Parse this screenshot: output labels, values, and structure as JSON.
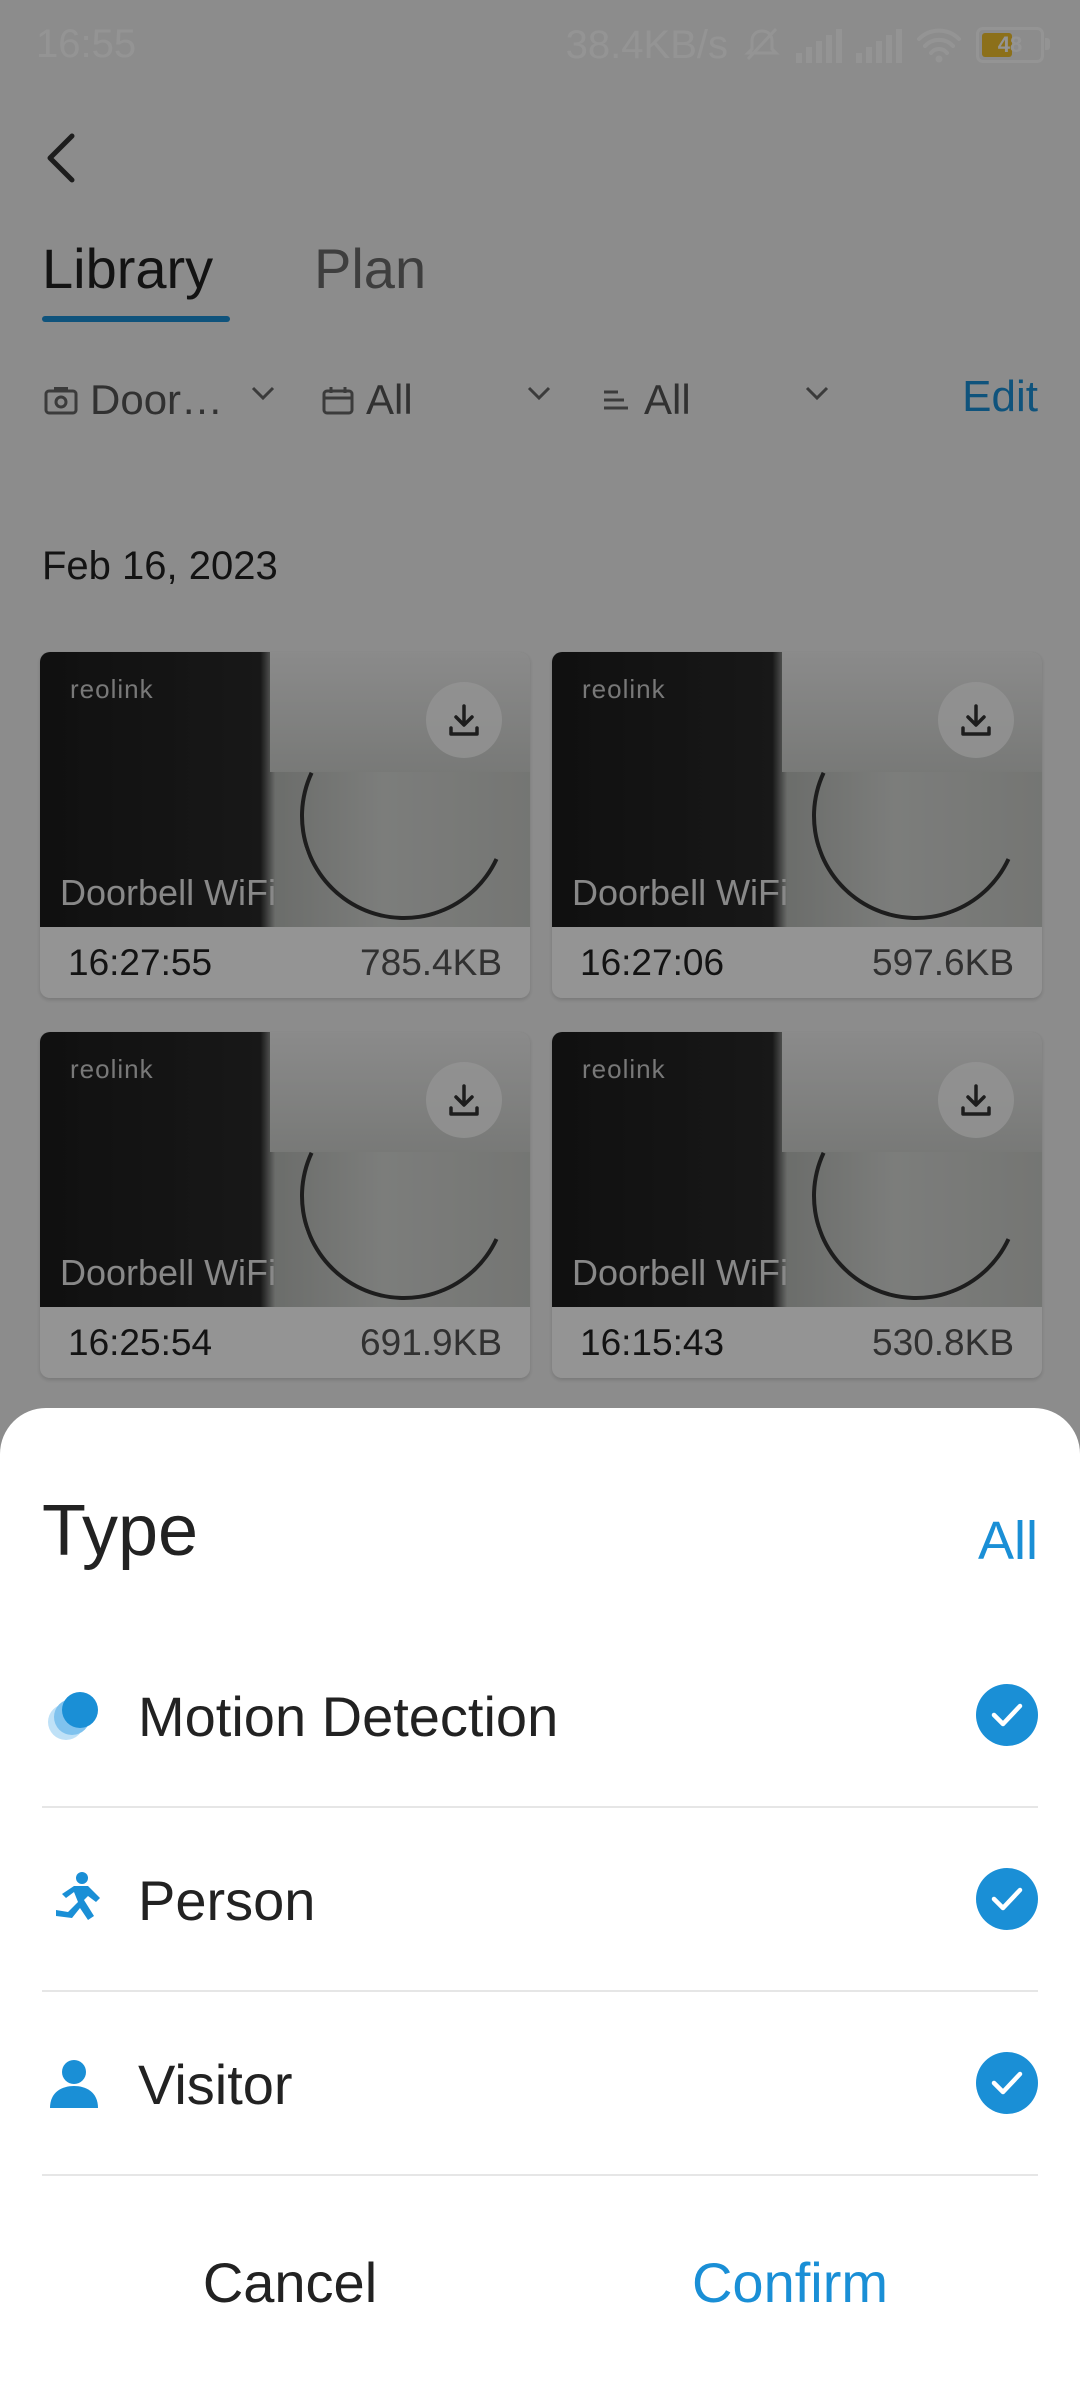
{
  "status_bar": {
    "time": "16:55",
    "network_speed": "38.4KB/s",
    "battery": "48"
  },
  "tabs": [
    {
      "label": "Library"
    },
    {
      "label": "Plan"
    }
  ],
  "filters": {
    "camera": "Door…",
    "date": "All",
    "type": "All",
    "edit_label": "Edit"
  },
  "date_header": "Feb 16, 2023",
  "recordings": [
    {
      "brand": "reolink",
      "camera": "Doorbell WiFi",
      "time": "16:27:55",
      "size": "785.4KB"
    },
    {
      "brand": "reolink",
      "camera": "Doorbell WiFi",
      "time": "16:27:06",
      "size": "597.6KB"
    },
    {
      "brand": "reolink",
      "camera": "Doorbell WiFi",
      "time": "16:25:54",
      "size": "691.9KB"
    },
    {
      "brand": "reolink",
      "camera": "Doorbell WiFi",
      "time": "16:15:43",
      "size": "530.8KB"
    }
  ],
  "sheet": {
    "title": "Type",
    "all_label": "All",
    "options": [
      {
        "label": "Motion Detection",
        "icon": "motion-icon",
        "checked": true
      },
      {
        "label": "Person",
        "icon": "person-running-icon",
        "checked": true
      },
      {
        "label": "Visitor",
        "icon": "visitor-icon",
        "checked": true
      }
    ],
    "cancel_label": "Cancel",
    "confirm_label": "Confirm"
  },
  "colors": {
    "accent": "#1a8fd6",
    "battery": "#f2c12e"
  }
}
